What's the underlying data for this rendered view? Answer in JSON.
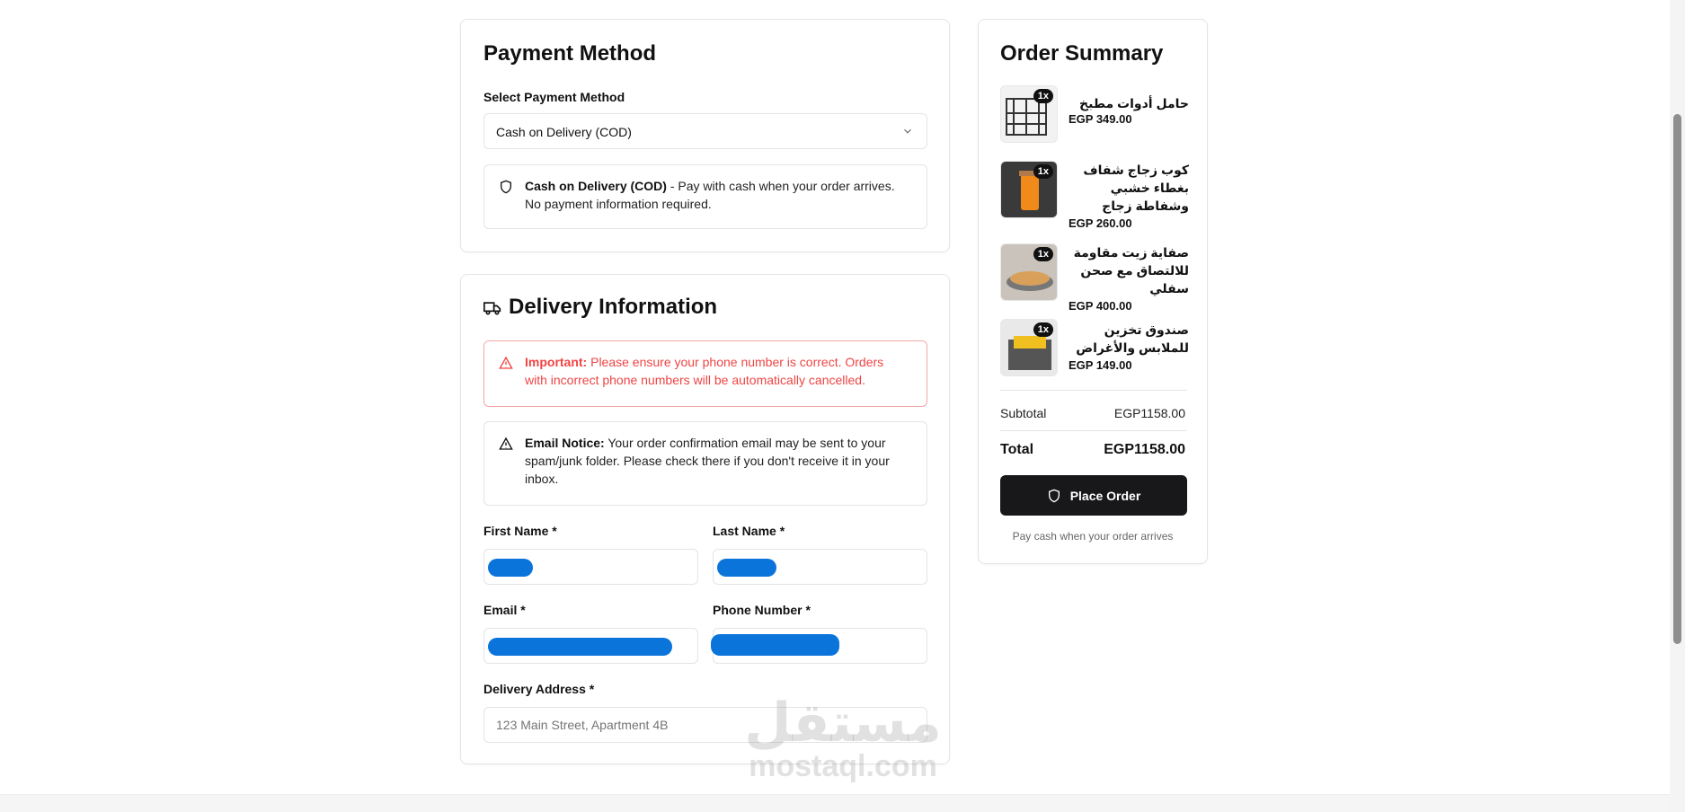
{
  "payment": {
    "title": "Payment Method",
    "select_label": "Select Payment Method",
    "selected_method": "Cash on Delivery (COD)",
    "notice_bold": "Cash on Delivery (COD)",
    "notice_text": " - Pay with cash when your order arrives. No payment information required."
  },
  "delivery": {
    "title": "Delivery Information",
    "important_bold": "Important:",
    "important_text": " Please ensure your phone number is correct. Orders with incorrect phone numbers will be automatically cancelled.",
    "email_bold": "Email Notice:",
    "email_text": " Your order confirmation email may be sent to your spam/junk folder. Please check there if you don't receive it in your inbox.",
    "first_name_label": "First Name *",
    "last_name_label": "Last Name *",
    "email_label": "Email *",
    "phone_label": "Phone Number *",
    "address_label": "Delivery Address *",
    "address_placeholder": "123 Main Street, Apartment 4B"
  },
  "summary": {
    "title": "Order Summary",
    "items": [
      {
        "name": "حامل أدوات مطبخ",
        "price": "EGP 349.00",
        "qty": "1x"
      },
      {
        "name": "كوب زجاج شفاف بغطاء خشبي وشفاطة زجاج",
        "price": "EGP 260.00",
        "qty": "1x"
      },
      {
        "name": "صفاية زيت مقاومة للالتصاق مع صحن سفلي",
        "price": "EGP 400.00",
        "qty": "1x"
      },
      {
        "name": "صندوق تخزين للملابس والأغراض",
        "price": "EGP 149.00",
        "qty": "1x"
      }
    ],
    "subtotal_label": "Subtotal",
    "subtotal_value": "EGP1158.00",
    "total_label": "Total",
    "total_value": "EGP1158.00",
    "place_order_label": "Place Order",
    "footnote": "Pay cash when your order arrives"
  },
  "watermark": {
    "arabic": "مستقل",
    "latin": "mostaql.com"
  },
  "colors": {
    "danger": "#ef4444",
    "redaction": "#0a74da",
    "button": "#18181b"
  }
}
